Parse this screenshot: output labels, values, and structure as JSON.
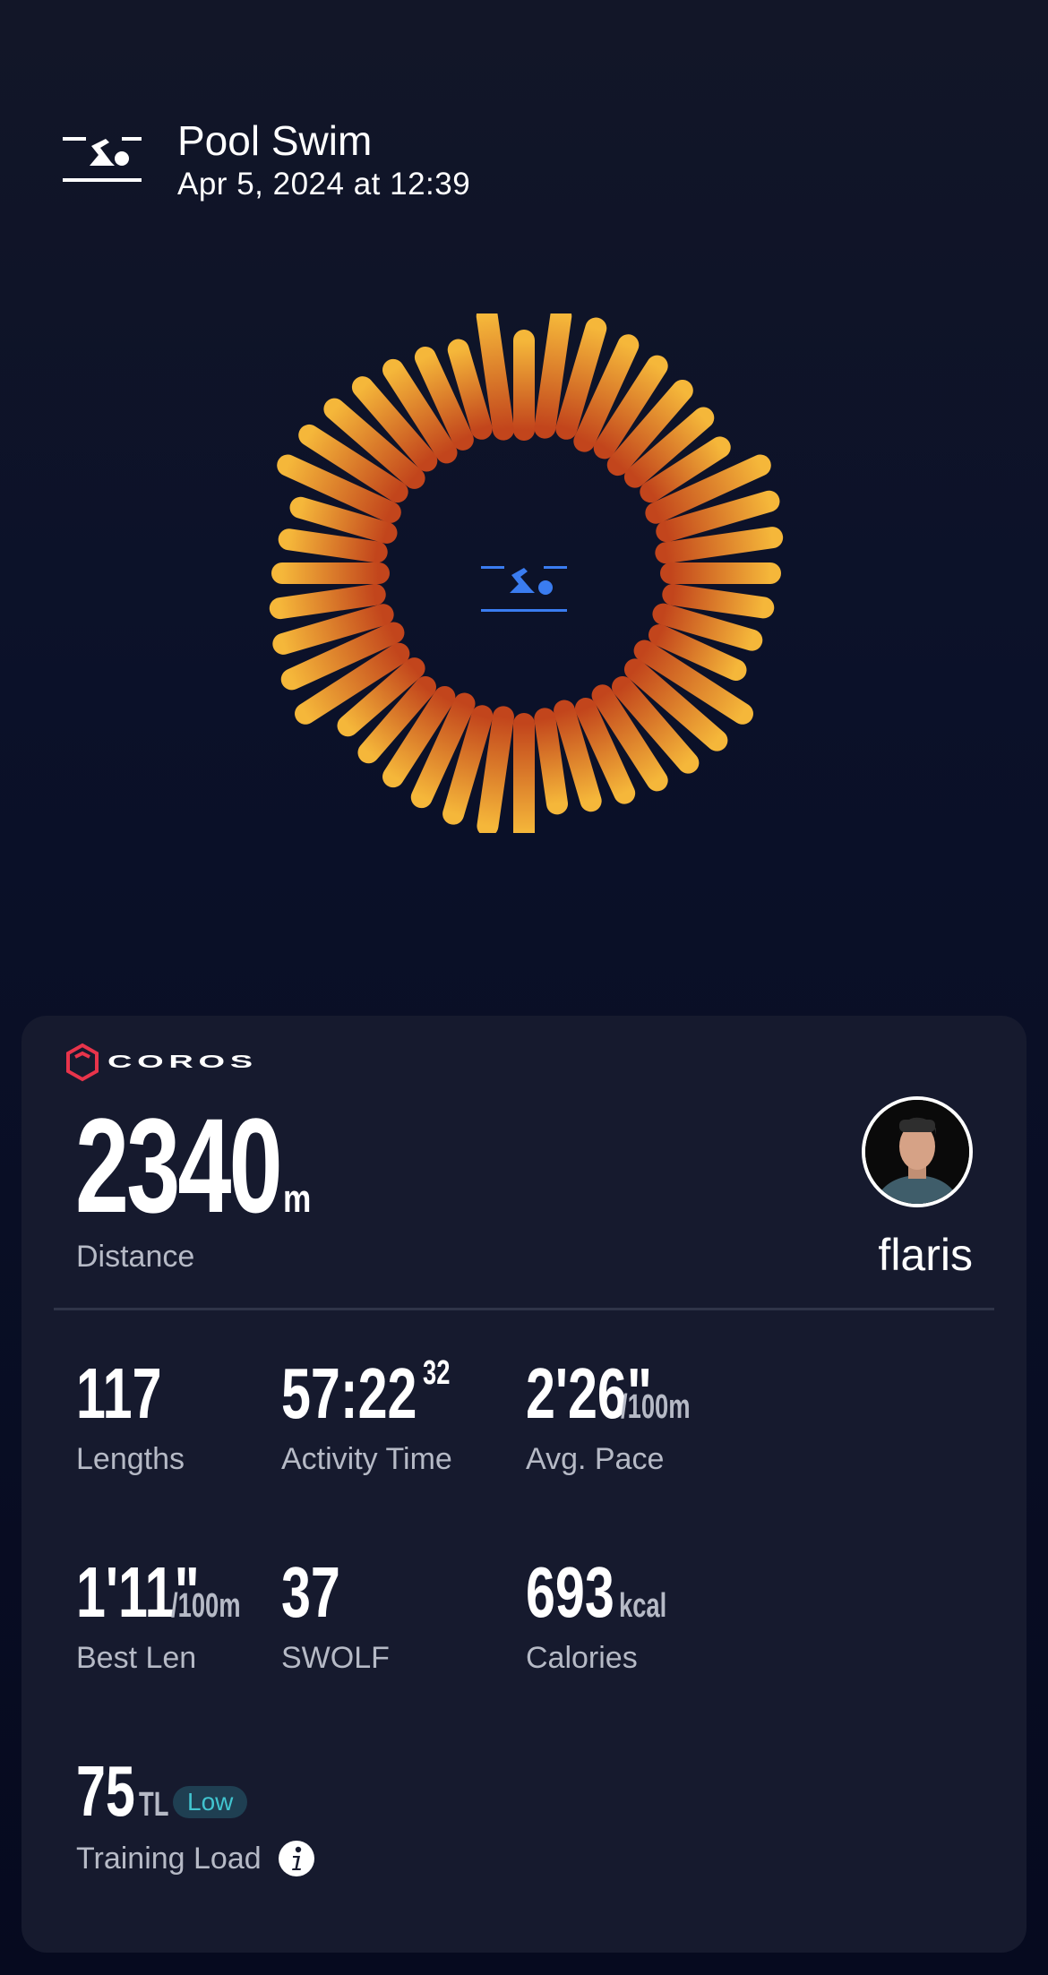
{
  "header": {
    "title": "Pool Swim",
    "date": "Apr 5, 2024 at 12:39",
    "icon": "pool-swim-icon"
  },
  "ring": {
    "center_icon": "pool-swim-icon",
    "colors": {
      "outer": "#f5b73a",
      "inner": "#c2451c"
    },
    "accent": "#3a7cf0"
  },
  "card": {
    "brand": "COROS",
    "brand_color": "#e8344b",
    "distance": {
      "value": "2340",
      "unit": "m",
      "label": "Distance"
    },
    "user": {
      "name": "flaris",
      "avatar": "avatar"
    },
    "stats": [
      {
        "id": "lengths",
        "value": "117",
        "unit": "",
        "sup": "",
        "label": "Lengths"
      },
      {
        "id": "activity-time",
        "value": "57:22",
        "unit": "",
        "sup": "32",
        "label": "Activity Time"
      },
      {
        "id": "avg-pace",
        "value": "2'26\"",
        "unit": "/100m",
        "sup": "",
        "label": "Avg. Pace"
      },
      {
        "id": "best-len",
        "value": "1'11\"",
        "unit": "/100m",
        "sup": "",
        "label": "Best Len"
      },
      {
        "id": "swolf",
        "value": "37",
        "unit": "",
        "sup": "",
        "label": "SWOLF"
      },
      {
        "id": "calories",
        "value": "693",
        "unit": "kcal",
        "sup": "",
        "label": "Calories"
      }
    ],
    "training_load": {
      "value": "75",
      "unit": "TL",
      "badge": "Low",
      "label": "Training Load",
      "badge_color": "#41c4cf"
    }
  }
}
